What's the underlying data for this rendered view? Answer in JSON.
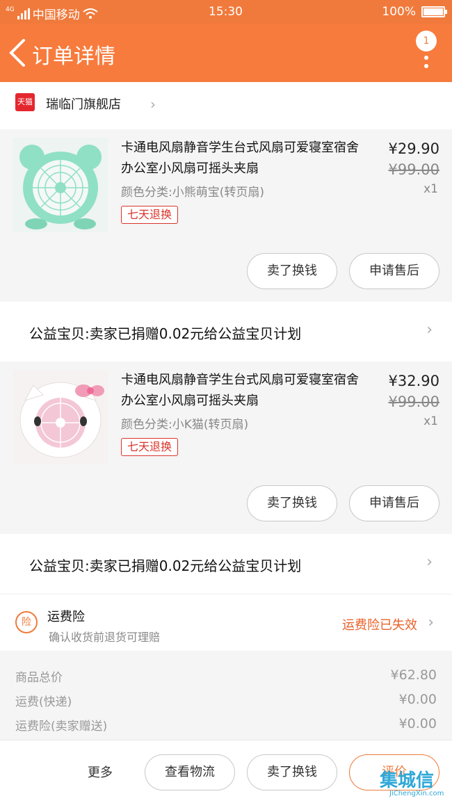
{
  "status_bar": {
    "network": "4G",
    "carrier": "中国移动",
    "time": "15:30",
    "battery": "100%"
  },
  "nav": {
    "title": "订单详情",
    "badge": "1",
    "back_icon": "chevron-left-icon",
    "more_icon": "more-vertical-icon"
  },
  "shop": {
    "platform_badge": "天猫",
    "name": "瑞临门旗舰店"
  },
  "items": [
    {
      "name": "卡通电风扇静音学生台式风扇可爱寝室宿舍办公室小风扇可摇头夹扇",
      "sku": "颜色分类:小熊萌宝(转页扇)",
      "tag": "七天退换",
      "price": "¥29.90",
      "original_price": "¥99.00",
      "qty": "x1",
      "btn_exchange": "卖了换钱",
      "btn_aftersale": "申请售后",
      "thumb_color": "#8fe0c4"
    },
    {
      "name": "卡通电风扇静音学生台式风扇可爱寝室宿舍办公室小风扇可摇头夹扇",
      "sku": "颜色分类:小K猫(转页扇)",
      "tag": "七天退换",
      "price": "¥32.90",
      "original_price": "¥99.00",
      "qty": "x1",
      "btn_exchange": "卖了换钱",
      "btn_aftersale": "申请售后",
      "thumb_color": "#f6f0f0"
    }
  ],
  "charity": [
    "公益宝贝:卖家已捐赠0.02元给公益宝贝计划",
    "公益宝贝:卖家已捐赠0.02元给公益宝贝计划"
  ],
  "insurance": {
    "icon_text": "险",
    "title": "运费险",
    "subtitle": "确认收货前退货可理赔",
    "status": "运费险已失效"
  },
  "summary": [
    {
      "label": "商品总价",
      "value": "¥62.80"
    },
    {
      "label": "运费(快递)",
      "value": "¥0.00"
    },
    {
      "label": "运费险(卖家赠送)",
      "value": "¥0.00"
    }
  ],
  "bottom": {
    "more": "更多",
    "logistics": "查看物流",
    "exchange": "卖了换钱",
    "review": "评价"
  },
  "watermark": {
    "brand": "集城信",
    "url": "JiChengXin.com"
  },
  "colors": {
    "brand": "#f77b3d",
    "tag_red": "#d9342b"
  }
}
